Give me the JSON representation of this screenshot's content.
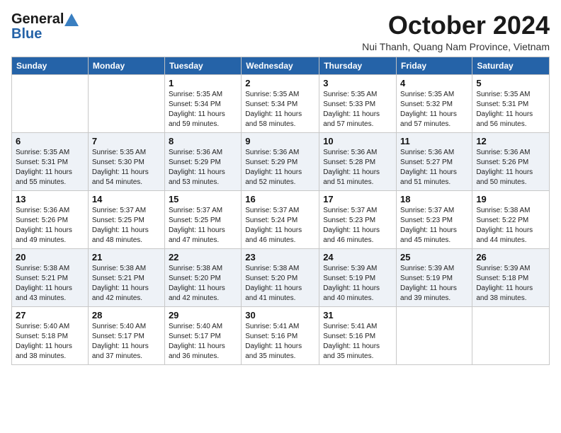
{
  "header": {
    "logo_line1": "General",
    "logo_line2": "Blue",
    "month": "October 2024",
    "location": "Nui Thanh, Quang Nam Province, Vietnam"
  },
  "columns": [
    "Sunday",
    "Monday",
    "Tuesday",
    "Wednesday",
    "Thursday",
    "Friday",
    "Saturday"
  ],
  "weeks": [
    [
      {
        "day": "",
        "info": ""
      },
      {
        "day": "",
        "info": ""
      },
      {
        "day": "1",
        "info": "Sunrise: 5:35 AM\nSunset: 5:34 PM\nDaylight: 11 hours\nand 59 minutes."
      },
      {
        "day": "2",
        "info": "Sunrise: 5:35 AM\nSunset: 5:34 PM\nDaylight: 11 hours\nand 58 minutes."
      },
      {
        "day": "3",
        "info": "Sunrise: 5:35 AM\nSunset: 5:33 PM\nDaylight: 11 hours\nand 57 minutes."
      },
      {
        "day": "4",
        "info": "Sunrise: 5:35 AM\nSunset: 5:32 PM\nDaylight: 11 hours\nand 57 minutes."
      },
      {
        "day": "5",
        "info": "Sunrise: 5:35 AM\nSunset: 5:31 PM\nDaylight: 11 hours\nand 56 minutes."
      }
    ],
    [
      {
        "day": "6",
        "info": "Sunrise: 5:35 AM\nSunset: 5:31 PM\nDaylight: 11 hours\nand 55 minutes."
      },
      {
        "day": "7",
        "info": "Sunrise: 5:35 AM\nSunset: 5:30 PM\nDaylight: 11 hours\nand 54 minutes."
      },
      {
        "day": "8",
        "info": "Sunrise: 5:36 AM\nSunset: 5:29 PM\nDaylight: 11 hours\nand 53 minutes."
      },
      {
        "day": "9",
        "info": "Sunrise: 5:36 AM\nSunset: 5:29 PM\nDaylight: 11 hours\nand 52 minutes."
      },
      {
        "day": "10",
        "info": "Sunrise: 5:36 AM\nSunset: 5:28 PM\nDaylight: 11 hours\nand 51 minutes."
      },
      {
        "day": "11",
        "info": "Sunrise: 5:36 AM\nSunset: 5:27 PM\nDaylight: 11 hours\nand 51 minutes."
      },
      {
        "day": "12",
        "info": "Sunrise: 5:36 AM\nSunset: 5:26 PM\nDaylight: 11 hours\nand 50 minutes."
      }
    ],
    [
      {
        "day": "13",
        "info": "Sunrise: 5:36 AM\nSunset: 5:26 PM\nDaylight: 11 hours\nand 49 minutes."
      },
      {
        "day": "14",
        "info": "Sunrise: 5:37 AM\nSunset: 5:25 PM\nDaylight: 11 hours\nand 48 minutes."
      },
      {
        "day": "15",
        "info": "Sunrise: 5:37 AM\nSunset: 5:25 PM\nDaylight: 11 hours\nand 47 minutes."
      },
      {
        "day": "16",
        "info": "Sunrise: 5:37 AM\nSunset: 5:24 PM\nDaylight: 11 hours\nand 46 minutes."
      },
      {
        "day": "17",
        "info": "Sunrise: 5:37 AM\nSunset: 5:23 PM\nDaylight: 11 hours\nand 46 minutes."
      },
      {
        "day": "18",
        "info": "Sunrise: 5:37 AM\nSunset: 5:23 PM\nDaylight: 11 hours\nand 45 minutes."
      },
      {
        "day": "19",
        "info": "Sunrise: 5:38 AM\nSunset: 5:22 PM\nDaylight: 11 hours\nand 44 minutes."
      }
    ],
    [
      {
        "day": "20",
        "info": "Sunrise: 5:38 AM\nSunset: 5:21 PM\nDaylight: 11 hours\nand 43 minutes."
      },
      {
        "day": "21",
        "info": "Sunrise: 5:38 AM\nSunset: 5:21 PM\nDaylight: 11 hours\nand 42 minutes."
      },
      {
        "day": "22",
        "info": "Sunrise: 5:38 AM\nSunset: 5:20 PM\nDaylight: 11 hours\nand 42 minutes."
      },
      {
        "day": "23",
        "info": "Sunrise: 5:38 AM\nSunset: 5:20 PM\nDaylight: 11 hours\nand 41 minutes."
      },
      {
        "day": "24",
        "info": "Sunrise: 5:39 AM\nSunset: 5:19 PM\nDaylight: 11 hours\nand 40 minutes."
      },
      {
        "day": "25",
        "info": "Sunrise: 5:39 AM\nSunset: 5:19 PM\nDaylight: 11 hours\nand 39 minutes."
      },
      {
        "day": "26",
        "info": "Sunrise: 5:39 AM\nSunset: 5:18 PM\nDaylight: 11 hours\nand 38 minutes."
      }
    ],
    [
      {
        "day": "27",
        "info": "Sunrise: 5:40 AM\nSunset: 5:18 PM\nDaylight: 11 hours\nand 38 minutes."
      },
      {
        "day": "28",
        "info": "Sunrise: 5:40 AM\nSunset: 5:17 PM\nDaylight: 11 hours\nand 37 minutes."
      },
      {
        "day": "29",
        "info": "Sunrise: 5:40 AM\nSunset: 5:17 PM\nDaylight: 11 hours\nand 36 minutes."
      },
      {
        "day": "30",
        "info": "Sunrise: 5:41 AM\nSunset: 5:16 PM\nDaylight: 11 hours\nand 35 minutes."
      },
      {
        "day": "31",
        "info": "Sunrise: 5:41 AM\nSunset: 5:16 PM\nDaylight: 11 hours\nand 35 minutes."
      },
      {
        "day": "",
        "info": ""
      },
      {
        "day": "",
        "info": ""
      }
    ]
  ]
}
